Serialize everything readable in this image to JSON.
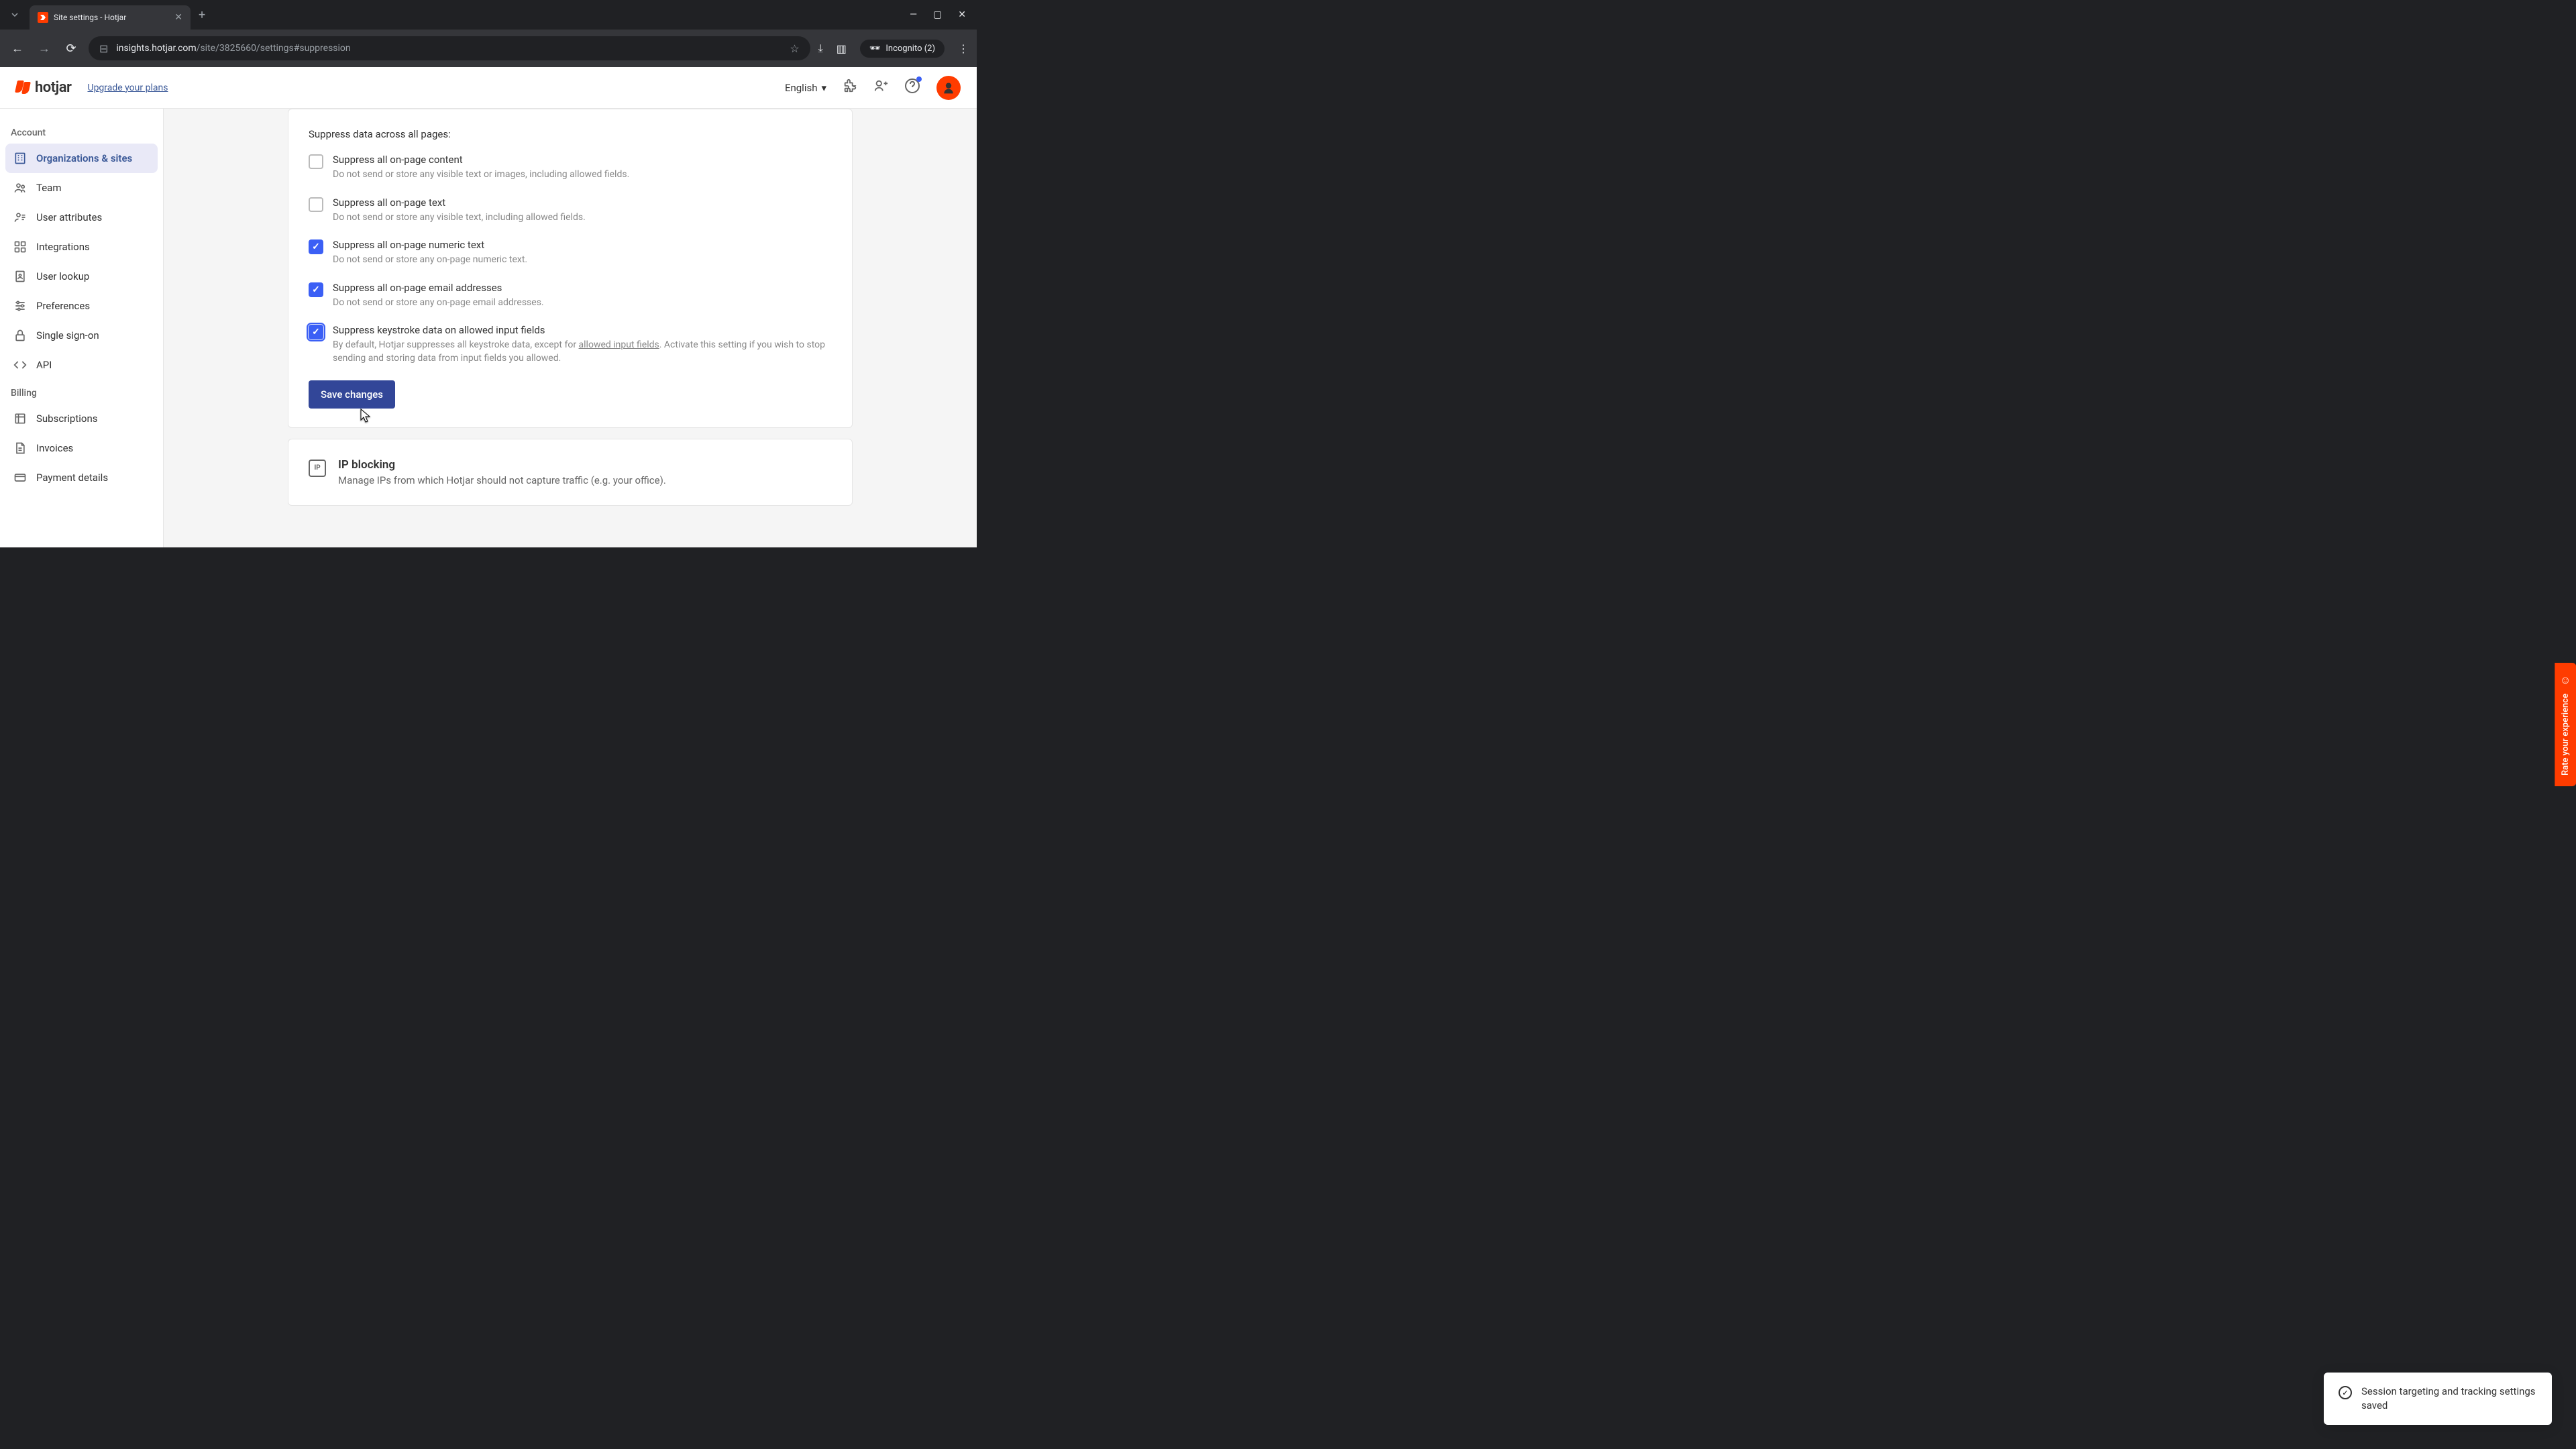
{
  "browser": {
    "tab_title": "Site settings - Hotjar",
    "url_domain": "insights.hotjar.com",
    "url_path": "/site/3825660/settings#suppression",
    "incognito_label": "Incognito (2)"
  },
  "header": {
    "brand": "hotjar",
    "upgrade_link": "Upgrade your plans",
    "language": "English"
  },
  "sidebar": {
    "sections": [
      {
        "label": "Account",
        "items": [
          {
            "label": "Organizations & sites",
            "icon": "building-icon",
            "active": true
          },
          {
            "label": "Team",
            "icon": "team-icon"
          },
          {
            "label": "User attributes",
            "icon": "user-attr-icon"
          },
          {
            "label": "Integrations",
            "icon": "integrations-icon"
          },
          {
            "label": "User lookup",
            "icon": "lookup-icon"
          },
          {
            "label": "Preferences",
            "icon": "preferences-icon"
          },
          {
            "label": "Single sign-on",
            "icon": "lock-icon"
          },
          {
            "label": "API",
            "icon": "code-icon"
          }
        ]
      },
      {
        "label": "Billing",
        "items": [
          {
            "label": "Subscriptions",
            "icon": "subscriptions-icon"
          },
          {
            "label": "Invoices",
            "icon": "invoices-icon"
          },
          {
            "label": "Payment details",
            "icon": "card-icon"
          }
        ]
      }
    ]
  },
  "suppress": {
    "section_title": "Suppress data across all pages:",
    "options": [
      {
        "label": "Suppress all on-page content",
        "desc": "Do not send or store any visible text or images, including allowed fields.",
        "checked": false
      },
      {
        "label": "Suppress all on-page text",
        "desc": "Do not send or store any visible text, including allowed fields.",
        "checked": false
      },
      {
        "label": "Suppress all on-page numeric text",
        "desc": "Do not send or store any on-page numeric text.",
        "checked": true
      },
      {
        "label": "Suppress all on-page email addresses",
        "desc": "Do not send or store any on-page email addresses.",
        "checked": true
      },
      {
        "label": "Suppress keystroke data on allowed input fields",
        "desc_prefix": "By default, Hotjar suppresses all keystroke data, except for ",
        "desc_link": "allowed input fields",
        "desc_suffix": ". Activate this setting if you wish to stop sending and storing data from input fields you allowed.",
        "checked": true,
        "focused": true
      }
    ],
    "save_label": "Save changes"
  },
  "ip_block": {
    "title": "IP blocking",
    "desc": "Manage IPs from which Hotjar should not capture traffic (e.g. your office).",
    "icon_text": "IP"
  },
  "feedback_tab": "Rate your experience",
  "toast": "Session targeting and tracking settings saved"
}
